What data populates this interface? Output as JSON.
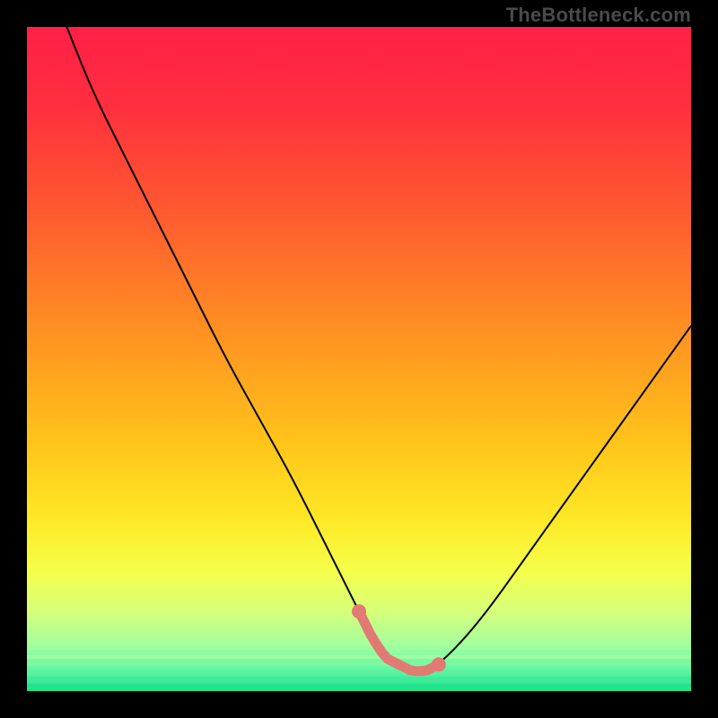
{
  "watermark": "TheBottleneck.com",
  "colors": {
    "black": "#000000",
    "curve": "#000000",
    "highlight": "#e27a74",
    "gradient_stops": [
      {
        "offset": 0.0,
        "color": "#ff1f47"
      },
      {
        "offset": 0.12,
        "color": "#ff2f3e"
      },
      {
        "offset": 0.28,
        "color": "#ff5a2f"
      },
      {
        "offset": 0.45,
        "color": "#ff8e23"
      },
      {
        "offset": 0.62,
        "color": "#ffc21a"
      },
      {
        "offset": 0.74,
        "color": "#ffe825"
      },
      {
        "offset": 0.82,
        "color": "#f4ff4a"
      },
      {
        "offset": 0.88,
        "color": "#d6ff7a"
      },
      {
        "offset": 0.93,
        "color": "#a4ff9c"
      },
      {
        "offset": 0.97,
        "color": "#5cf5a6"
      },
      {
        "offset": 1.0,
        "color": "#19e38a"
      }
    ]
  },
  "chart_data": {
    "type": "line",
    "title": "",
    "xlabel": "",
    "ylabel": "",
    "xlim": [
      0,
      100
    ],
    "ylim": [
      0,
      100
    ],
    "grid": false,
    "series": [
      {
        "name": "bottleneck-curve",
        "x": [
          6,
          10,
          15,
          20,
          25,
          30,
          35,
          40,
          45,
          48,
          50,
          52,
          54,
          56,
          58,
          60,
          62,
          66,
          70,
          75,
          80,
          85,
          90,
          95,
          100
        ],
        "y": [
          100,
          90,
          80,
          70,
          60,
          50,
          41,
          32,
          22,
          16,
          12,
          8,
          5,
          4,
          3,
          3,
          4,
          8,
          13,
          20,
          27,
          34,
          41,
          48,
          55
        ]
      }
    ],
    "highlight_region": {
      "name": "optimal-zone",
      "x": [
        50,
        62
      ],
      "y_approx": 3
    }
  }
}
